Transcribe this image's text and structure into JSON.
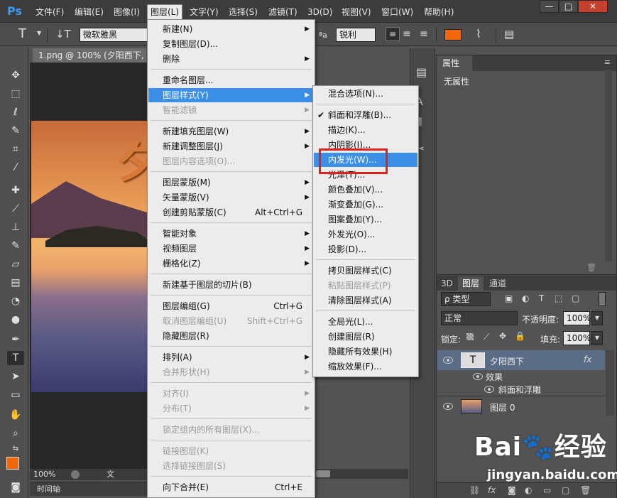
{
  "app": {
    "logo": "Ps"
  },
  "menubar": [
    {
      "label": "文件(F)",
      "active": false
    },
    {
      "label": "编辑(E)",
      "active": false
    },
    {
      "label": "图像(I)",
      "active": false
    },
    {
      "label": "图层(L)",
      "active": true
    },
    {
      "label": "文字(Y)",
      "active": false
    },
    {
      "label": "选择(S)",
      "active": false
    },
    {
      "label": "滤镜(T)",
      "active": false
    },
    {
      "label": "3D(D)",
      "active": false
    },
    {
      "label": "视图(V)",
      "active": false
    },
    {
      "label": "窗口(W)",
      "active": false
    },
    {
      "label": "帮助(H)",
      "active": false
    }
  ],
  "window_controls": {
    "minimize": "—",
    "maximize": "□",
    "close": "✕"
  },
  "options": {
    "font_family": "微软雅黑",
    "antialias": "锐利",
    "aa_label": "ªa",
    "text_color": "#f0680a"
  },
  "document": {
    "tab_title": "1.png @ 100% (夕阳西下, R",
    "zoom": "100%",
    "doc_info": "文档:735.6",
    "image_text": "夕",
    "timeline": "时间轴"
  },
  "properties": {
    "tab": "属性",
    "body": "无属性"
  },
  "layers_panel": {
    "tabs": [
      "3D",
      "图层",
      "通道"
    ],
    "filter": "ρ 类型",
    "blend_mode": "正常",
    "opacity_label": "不透明度:",
    "opacity": "100%",
    "lock_label": "锁定:",
    "fill_label": "填充:",
    "fill": "100%",
    "layers": [
      {
        "name": "夕阳西下",
        "fx": "fx",
        "kind": "text",
        "thumb_text": "T"
      },
      {
        "name": "效果",
        "kind": "effect-group"
      },
      {
        "name": "斜面和浮雕",
        "kind": "effect"
      },
      {
        "name": "图层 0",
        "kind": "image"
      }
    ]
  },
  "layer_menu": {
    "items": [
      {
        "label": "新建(N)",
        "submenu": true
      },
      {
        "label": "复制图层(D)..."
      },
      {
        "label": "删除",
        "submenu": true
      },
      {
        "sep": true
      },
      {
        "label": "重命名图层..."
      },
      {
        "label": "图层样式(Y)",
        "submenu": true,
        "highlight": true
      },
      {
        "label": "智能滤镜",
        "submenu": true,
        "disabled": true
      },
      {
        "sep": true
      },
      {
        "label": "新建填充图层(W)",
        "submenu": true
      },
      {
        "label": "新建调整图层(J)",
        "submenu": true
      },
      {
        "label": "图层内容选项(O)...",
        "disabled": true
      },
      {
        "sep": true
      },
      {
        "label": "图层蒙版(M)",
        "submenu": true
      },
      {
        "label": "矢量蒙版(V)",
        "submenu": true
      },
      {
        "label": "创建剪贴蒙版(C)",
        "shortcut": "Alt+Ctrl+G"
      },
      {
        "sep": true
      },
      {
        "label": "智能对象",
        "submenu": true
      },
      {
        "label": "视频图层",
        "submenu": true
      },
      {
        "label": "栅格化(Z)",
        "submenu": true
      },
      {
        "sep": true
      },
      {
        "label": "新建基于图层的切片(B)"
      },
      {
        "sep": true
      },
      {
        "label": "图层编组(G)",
        "shortcut": "Ctrl+G"
      },
      {
        "label": "取消图层编组(U)",
        "shortcut": "Shift+Ctrl+G",
        "disabled": true
      },
      {
        "label": "隐藏图层(R)"
      },
      {
        "sep": true
      },
      {
        "label": "排列(A)",
        "submenu": true
      },
      {
        "label": "合并形状(H)",
        "submenu": true,
        "disabled": true
      },
      {
        "sep": true
      },
      {
        "label": "对齐(I)",
        "submenu": true,
        "disabled": true
      },
      {
        "label": "分布(T)",
        "submenu": true,
        "disabled": true
      },
      {
        "sep": true
      },
      {
        "label": "锁定组内的所有图层(X)...",
        "disabled": true
      },
      {
        "sep": true
      },
      {
        "label": "链接图层(K)",
        "disabled": true
      },
      {
        "label": "选择链接图层(S)",
        "disabled": true
      },
      {
        "sep": true
      },
      {
        "label": "向下合并(E)",
        "shortcut": "Ctrl+E"
      }
    ]
  },
  "style_menu": {
    "items": [
      {
        "label": "混合选项(N)..."
      },
      {
        "sep": true
      },
      {
        "label": "斜面和浮雕(B)...",
        "checked": true
      },
      {
        "label": "描边(K)..."
      },
      {
        "label": "内阴影(I)..."
      },
      {
        "label": "内发光(W)...",
        "highlight": true
      },
      {
        "label": "光泽(T)..."
      },
      {
        "label": "颜色叠加(V)..."
      },
      {
        "label": "渐变叠加(G)..."
      },
      {
        "label": "图案叠加(Y)..."
      },
      {
        "label": "外发光(O)..."
      },
      {
        "label": "投影(D)..."
      },
      {
        "sep": true
      },
      {
        "label": "拷贝图层样式(C)"
      },
      {
        "label": "粘贴图层样式(P)",
        "disabled": true
      },
      {
        "label": "清除图层样式(A)"
      },
      {
        "sep": true
      },
      {
        "label": "全局光(L)..."
      },
      {
        "label": "创建图层(R)"
      },
      {
        "label": "隐藏所有效果(H)"
      },
      {
        "label": "缩放效果(F)..."
      }
    ]
  },
  "watermark": {
    "logo": "Bai🐾经验",
    "url": "jingyan.baidu.com"
  }
}
